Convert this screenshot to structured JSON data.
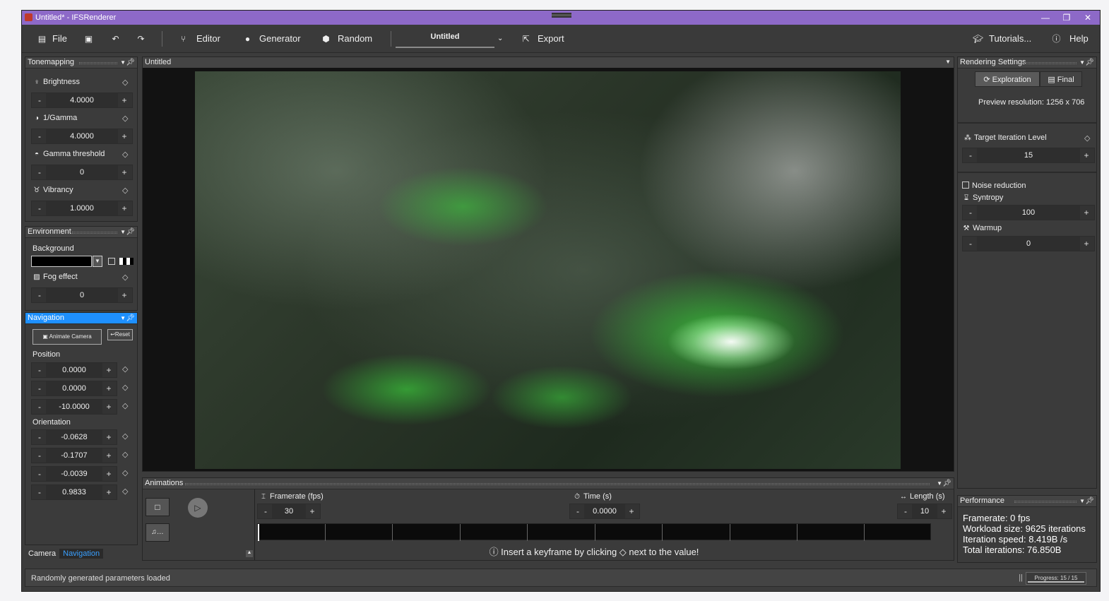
{
  "window": {
    "title": "Untitled* - IFSRenderer"
  },
  "toolbar": {
    "file": "File",
    "editor": "Editor",
    "generator": "Generator",
    "random": "Random",
    "tab": "Untitled",
    "export": "Export",
    "tutorials": "Tutorials...",
    "help": "Help"
  },
  "tonemapping": {
    "title": "Tonemapping",
    "brightness": {
      "label": "Brightness",
      "value": "4.0000"
    },
    "gamma": {
      "label": "1/Gamma",
      "value": "4.0000"
    },
    "gamma_threshold": {
      "label": "Gamma threshold",
      "value": "0"
    },
    "vibrancy": {
      "label": "Vibrancy",
      "value": "1.0000"
    }
  },
  "environment": {
    "title": "Environment",
    "background_label": "Background",
    "background_color": "#000000",
    "fog": {
      "label": "Fog effect",
      "value": "0"
    }
  },
  "navigation": {
    "title": "Navigation",
    "animate_camera": "Animate Camera",
    "reset": "Reset",
    "position_label": "Position",
    "position": [
      "0.0000",
      "0.0000",
      "-10.0000"
    ],
    "orientation_label": "Orientation",
    "orientation": [
      "-0.0628",
      "-0.1707",
      "-0.0039",
      "0.9833"
    ]
  },
  "bottom_tabs": [
    "Camera",
    "Navigation"
  ],
  "viewport": {
    "title": "Untitled"
  },
  "animations": {
    "title": "Animations",
    "framerate_label": "Framerate (fps)",
    "framerate": "30",
    "time_label": "Time (s)",
    "time": "0.0000",
    "length_label": "Length (s)",
    "length": "10",
    "hint": "ⓘ Insert a keyframe by clicking ◇ next to the value!"
  },
  "rendering": {
    "title": "Rendering Settings",
    "exploration": "Exploration",
    "final": "Final",
    "preview_resolution": "Preview resolution: 1256 x 706",
    "target_iteration": {
      "label": "Target Iteration Level",
      "value": "15"
    },
    "noise_reduction": "Noise reduction",
    "syntropy": {
      "label": "Syntropy",
      "value": "100"
    },
    "warmup": {
      "label": "Warmup",
      "value": "0"
    }
  },
  "performance": {
    "title": "Performance",
    "framerate": "Framerate: 0 fps",
    "workload": "Workload size: 9625 iterations",
    "speed": "Iteration speed: 8.419B /s",
    "total": "Total iterations: 76.850B"
  },
  "status": {
    "message": "Randomly generated parameters loaded",
    "progress_text": "Progress: 15 / 15",
    "progress_fraction": 1.0
  },
  "colors": {
    "accent": "#1e90ff",
    "titlebar": "#8d69c8"
  }
}
